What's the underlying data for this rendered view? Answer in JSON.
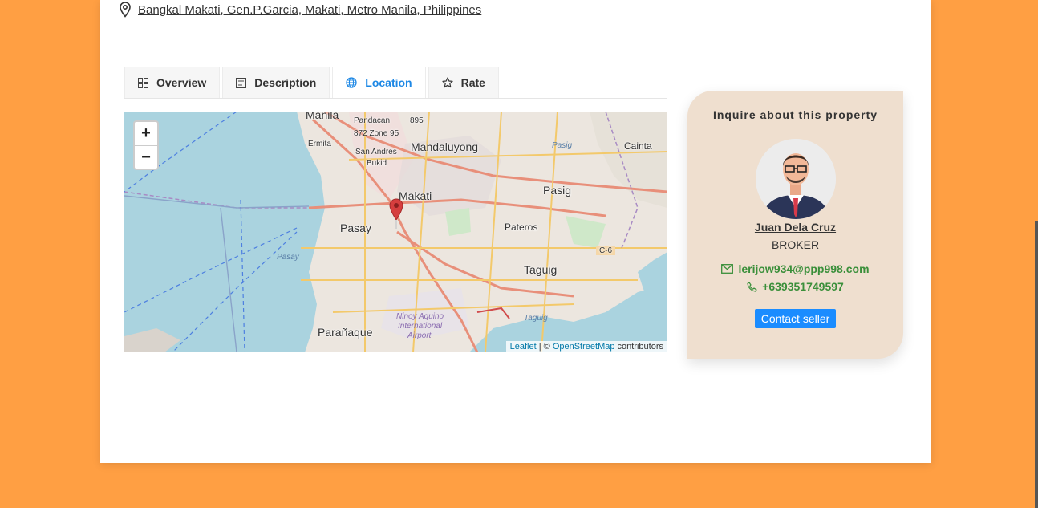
{
  "property": {
    "address": "Bangkal Makati, Gen.P.Garcia, Makati, Metro Manila, Philippines"
  },
  "tabs": [
    {
      "label": "Overview",
      "icon": "grid-icon"
    },
    {
      "label": "Description",
      "icon": "document-icon"
    },
    {
      "label": "Location",
      "icon": "globe-icon",
      "active": true
    },
    {
      "label": "Rate",
      "icon": "star-icon"
    }
  ],
  "map": {
    "zoom_in": "+",
    "zoom_out": "−",
    "attribution": {
      "leaflet": "Leaflet",
      "sep": " | © ",
      "osm": "OpenStreetMap",
      "suffix": " contributors"
    },
    "labels": {
      "manila": "Manila",
      "pandacan": "Pandacan",
      "n895": "895",
      "ermita": "Ermita",
      "zone95": "872 Zone 95",
      "sanandres": "San Andres",
      "bukid": "Bukid",
      "mandaluyong": "Mandaluyong",
      "pasig_river": "Pasig",
      "cainta": "Cainta",
      "makati": "Makati",
      "pasig": "Pasig",
      "pasay": "Pasay",
      "pateros": "Pateros",
      "c6": "C-6",
      "taguig": "Taguig",
      "pasay_water": "Pasay",
      "taguig_water": "Taguig",
      "airport1": "Ninoy Aquino",
      "airport2": "International",
      "airport3": "Airport",
      "paranaque": "Parañaque"
    }
  },
  "inquiry": {
    "title": "Inquire about this property",
    "agent_name": "Juan Dela Cruz",
    "agent_role": "BROKER",
    "email": "lerijow934@ppp998.com",
    "phone": "+639351749597",
    "button": "Contact seller"
  },
  "colors": {
    "background": "#ff9f43",
    "accent": "#1a8cff",
    "contact_green": "#3a8f3a",
    "card": "#efdfcf"
  }
}
